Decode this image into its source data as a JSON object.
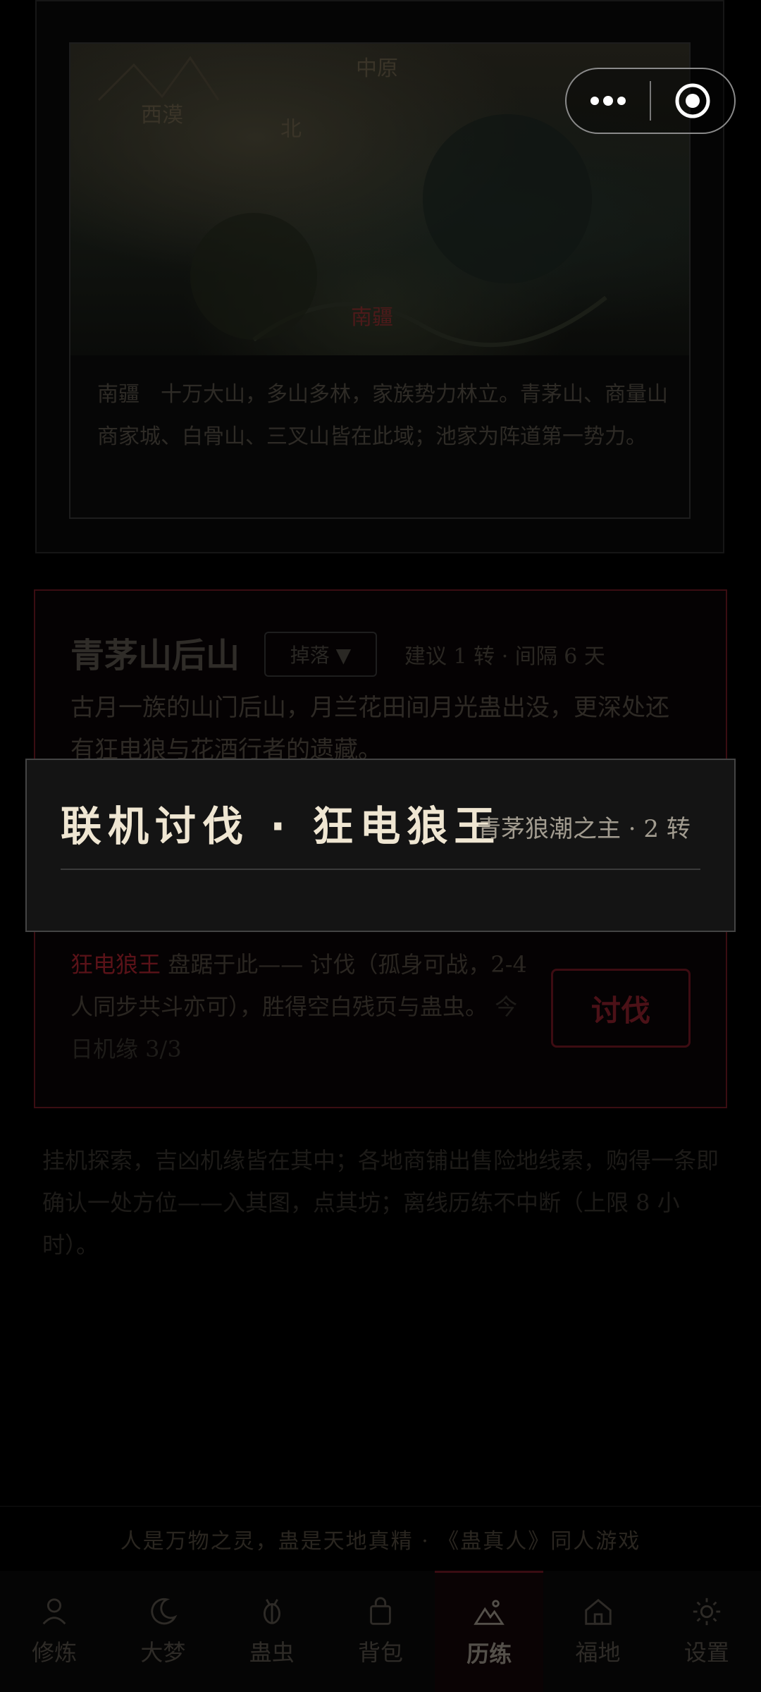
{
  "map": {
    "labels": {
      "central_plains": "中原",
      "west_desert": "西漠",
      "north": "北",
      "south_border": "南疆"
    },
    "description": "南疆　十万大山，多山多林，家族势力林立。青茅山、商量山商家城、白骨山、三叉山皆在此域；池家为阵道第一势力。"
  },
  "area": {
    "title": "青茅山后山",
    "loot_label": "掉落 ▼",
    "hint": "建议 1 转 · 间隔 6 天",
    "description": "古月一族的山门后山，月兰花田间月光蛊出没，更深处还有狂电狼与花酒行者的遗藏。"
  },
  "boss": {
    "name": "狂电狼王",
    "text": " 盘踞于此—— 讨伐（孤身可战，2-4 人同步共斗亦可），胜得空白残页与蛊虫。",
    "quota": "今日机缘 3/3",
    "fight_label": "讨伐"
  },
  "footnote": "挂机探索，吉凶机缘皆在其中；各地商铺出售险地线索，购得一条即确认一处方位——入其图，点其坊；离线历练不中断（上限 8 小时）。",
  "motto": "人是万物之灵，蛊是天地真精 · 《蛊真人》同人游戏",
  "tabs": [
    {
      "label": "修炼",
      "icon": "person-icon",
      "active": false
    },
    {
      "label": "大梦",
      "icon": "moon-icon",
      "active": false
    },
    {
      "label": "蛊虫",
      "icon": "bug-icon",
      "active": false
    },
    {
      "label": "背包",
      "icon": "bag-icon",
      "active": false
    },
    {
      "label": "历练",
      "icon": "mountain-icon",
      "active": true
    },
    {
      "label": "福地",
      "icon": "home-icon",
      "active": false
    },
    {
      "label": "设置",
      "icon": "sun-gear-icon",
      "active": false
    }
  ],
  "modal": {
    "title": "联机讨伐 · 狂电狼王",
    "subtitle": "青茅狼潮之主 · 2 转"
  },
  "colors": {
    "accent_red": "#5a1218",
    "modal_bg": "#141414",
    "title": "#efe6d2"
  }
}
